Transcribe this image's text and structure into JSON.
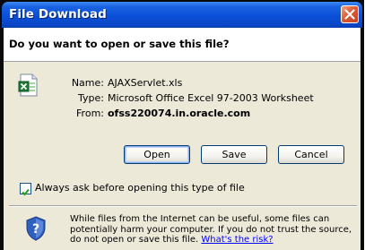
{
  "window": {
    "title": "File Download",
    "close_icon": "close-icon"
  },
  "dialog": {
    "question": "Do you want to open or save this file?",
    "file_icon": "excel-file-icon",
    "fields": [
      {
        "label": "Name:",
        "value": "AJAXServlet.xls"
      },
      {
        "label": "Type:",
        "value": "Microsoft Office Excel 97-2003 Worksheet"
      },
      {
        "label": "From:",
        "value": "ofss220074.in.oracle.com"
      }
    ],
    "buttons": {
      "open": "Open",
      "save": "Save",
      "cancel": "Cancel"
    },
    "checkbox": {
      "label": "Always ask before opening this type of file",
      "checked": true
    },
    "warning": {
      "icon": "shield-question-icon",
      "text": "While files from the Internet can be useful, some files can potentially harm your computer. If you do not trust the source, do not open or save this file.",
      "link": "What's the risk?"
    }
  },
  "colors": {
    "titlebar": "#0a4fd8",
    "client_bg": "#ece9d8",
    "close_button": "#e05a34",
    "link": "#0000ff"
  }
}
